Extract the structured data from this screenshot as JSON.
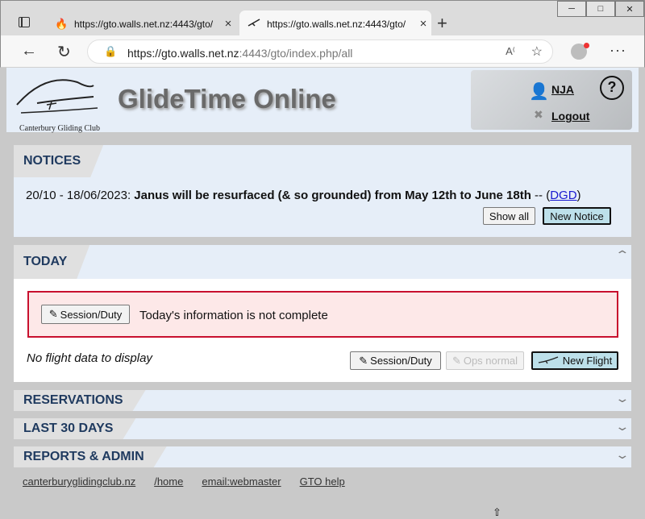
{
  "browser": {
    "tabs": [
      {
        "title": "https://gto.walls.net.nz:4443/gto/",
        "icon": "flame-icon"
      },
      {
        "title": "https://gto.walls.net.nz:4443/gto/",
        "icon": "glider-icon"
      }
    ],
    "url_host": "https://gto.walls.net.nz",
    "url_rest": ":4443/gto/index.php/all"
  },
  "header": {
    "app_title": "GlideTime Online",
    "logo_text": "Canterbury Gliding Club",
    "user": "NJA",
    "logout": "Logout",
    "help": "?"
  },
  "notices": {
    "heading": "NOTICES",
    "date_prefix": "20/10 - 18/06/2023:",
    "text": "Janus will be resurfaced (& so grounded) from May 12th to June 18th",
    "sep": " -- (",
    "author": "DGD",
    "close": ")",
    "show_all": "Show all",
    "new_notice": "New Notice"
  },
  "today": {
    "heading": "TODAY",
    "alert_button": "Session/Duty",
    "alert_text": "Today's information is not complete",
    "no_flight": "No flight data to display",
    "session_button": "Session/Duty",
    "ops_button": "Ops normal",
    "new_flight_button": "New Flight"
  },
  "sections": {
    "reservations": "RESERVATIONS",
    "last30": "LAST 30 DAYS",
    "reports": "REPORTS & ADMIN"
  },
  "footer": {
    "links": [
      "canterburyglidingclub.nz",
      "/home",
      "email:webmaster",
      "GTO help"
    ]
  }
}
